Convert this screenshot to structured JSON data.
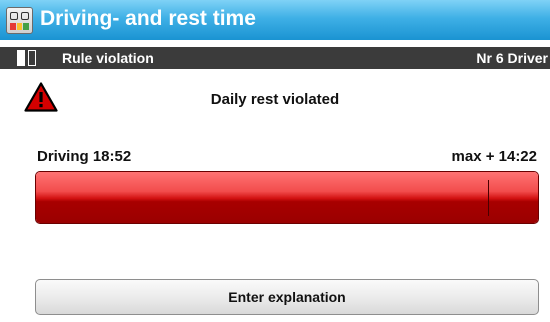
{
  "window": {
    "title": "Driving- and rest time",
    "icon": "tachograph-app-icon"
  },
  "subheader": {
    "left_label": "Rule violation",
    "right_label": "Nr 6 Driver",
    "icon": "driver-card-slots-icon"
  },
  "alert": {
    "icon": "warning-triangle-icon",
    "message": "Daily rest violated"
  },
  "driving": {
    "label": "Driving 18:52",
    "limit_label": "max + 14:22",
    "progress": 1.0
  },
  "actions": {
    "explain_label": "Enter explanation"
  },
  "colors": {
    "titlebar": "#3fb0e6",
    "subbar": "#3b3b3b",
    "violation": "#c80000"
  }
}
